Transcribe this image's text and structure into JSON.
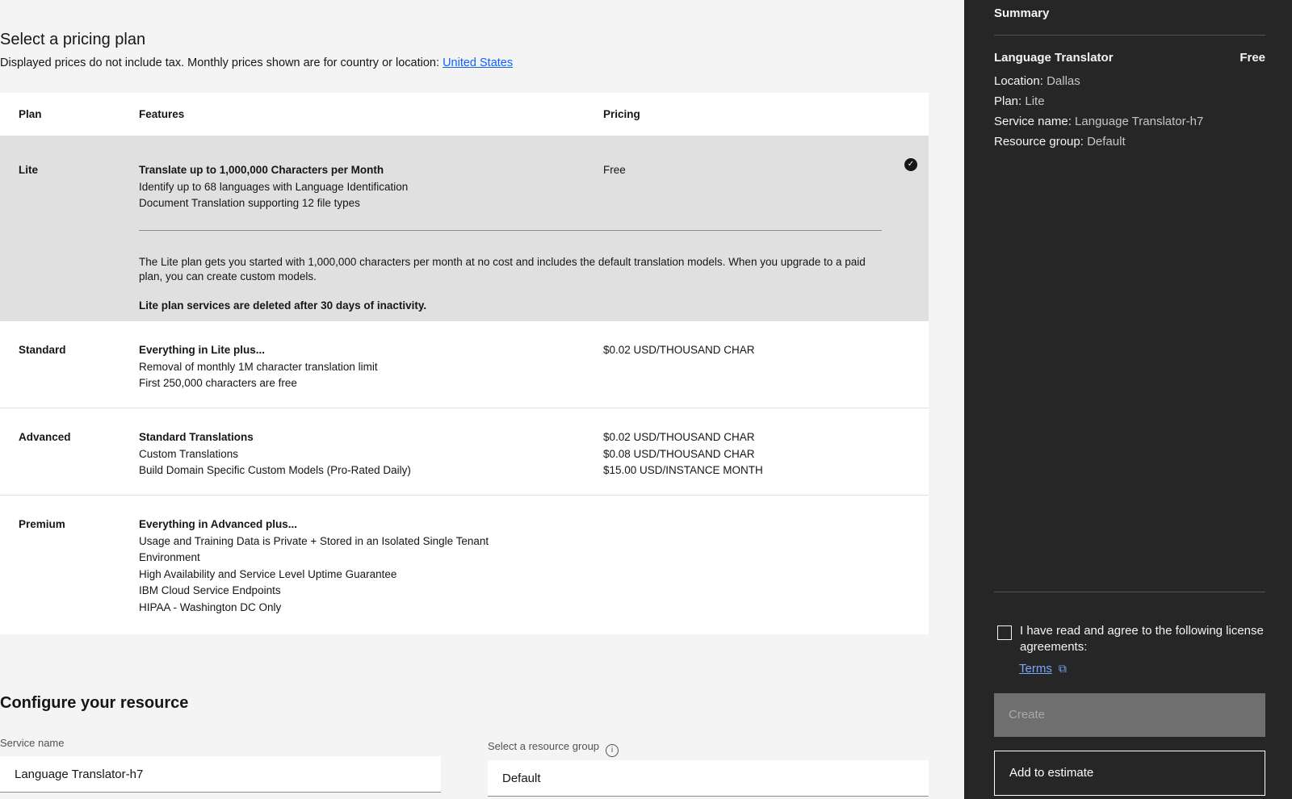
{
  "pricing": {
    "title": "Select a pricing plan",
    "subtitle": "Displayed prices do not include tax. Monthly prices shown are for country or location: ",
    "location_link": "United States",
    "headers": {
      "plan": "Plan",
      "features": "Features",
      "pricing": "Pricing"
    },
    "plans": [
      {
        "name": "Lite",
        "selected": true,
        "features_head": "Translate up to 1,000,000 Characters per Month",
        "features": [
          "Identify up to 68 languages with Language Identification",
          "Document Translation supporting 12 file types"
        ],
        "pricing": [
          "Free"
        ],
        "description": "The Lite plan gets you started with 1,000,000 characters per month at no cost and includes the default translation models. When you upgrade to a paid plan, you can create custom models.",
        "note": "Lite plan services are deleted after 30 days of inactivity."
      },
      {
        "name": "Standard",
        "features_head": "Everything in Lite plus...",
        "features": [
          "Removal of monthly 1M character translation limit",
          "First 250,000 characters are free"
        ],
        "pricing": [
          "$0.02 USD/THOUSAND CHAR"
        ]
      },
      {
        "name": "Advanced",
        "features_head": "Standard Translations",
        "features": [
          "Custom Translations",
          "Build Domain Specific Custom Models (Pro-Rated Daily)"
        ],
        "pricing": [
          "$0.02 USD/THOUSAND CHAR",
          "$0.08 USD/THOUSAND CHAR",
          "$15.00 USD/INSTANCE MONTH"
        ]
      },
      {
        "name": "Premium",
        "features_head": "Everything in Advanced plus...",
        "features": [
          "Usage and Training Data is Private + Stored in an Isolated Single Tenant",
          "Environment",
          "High Availability and Service Level Uptime Guarantee",
          "IBM Cloud Service Endpoints",
          "HIPAA - Washington DC Only"
        ],
        "pricing": []
      }
    ]
  },
  "configure": {
    "title": "Configure your resource",
    "service_name_label": "Service name",
    "service_name_value": "Language Translator-h7",
    "resource_group_label": "Select a resource group",
    "resource_group_value": "Default",
    "info_icon": "info-icon"
  },
  "summary": {
    "title": "Summary",
    "service": "Language Translator",
    "price": "Free",
    "location_key": "Location:",
    "location_value": "Dallas",
    "plan_key": "Plan:",
    "plan_value": "Lite",
    "service_name_key": "Service name:",
    "service_name_value": "Language Translator-h7",
    "resource_group_key": "Resource group:",
    "resource_group_value": "Default",
    "agree_text": "I have read and agree to the following license agreements:",
    "terms_link": "Terms",
    "create_label": "Create",
    "estimate_label": "Add to estimate"
  },
  "colors": {
    "link": "#0f62fe",
    "sidebar_bg": "#262626",
    "selected_row": "#e0e0e0"
  }
}
